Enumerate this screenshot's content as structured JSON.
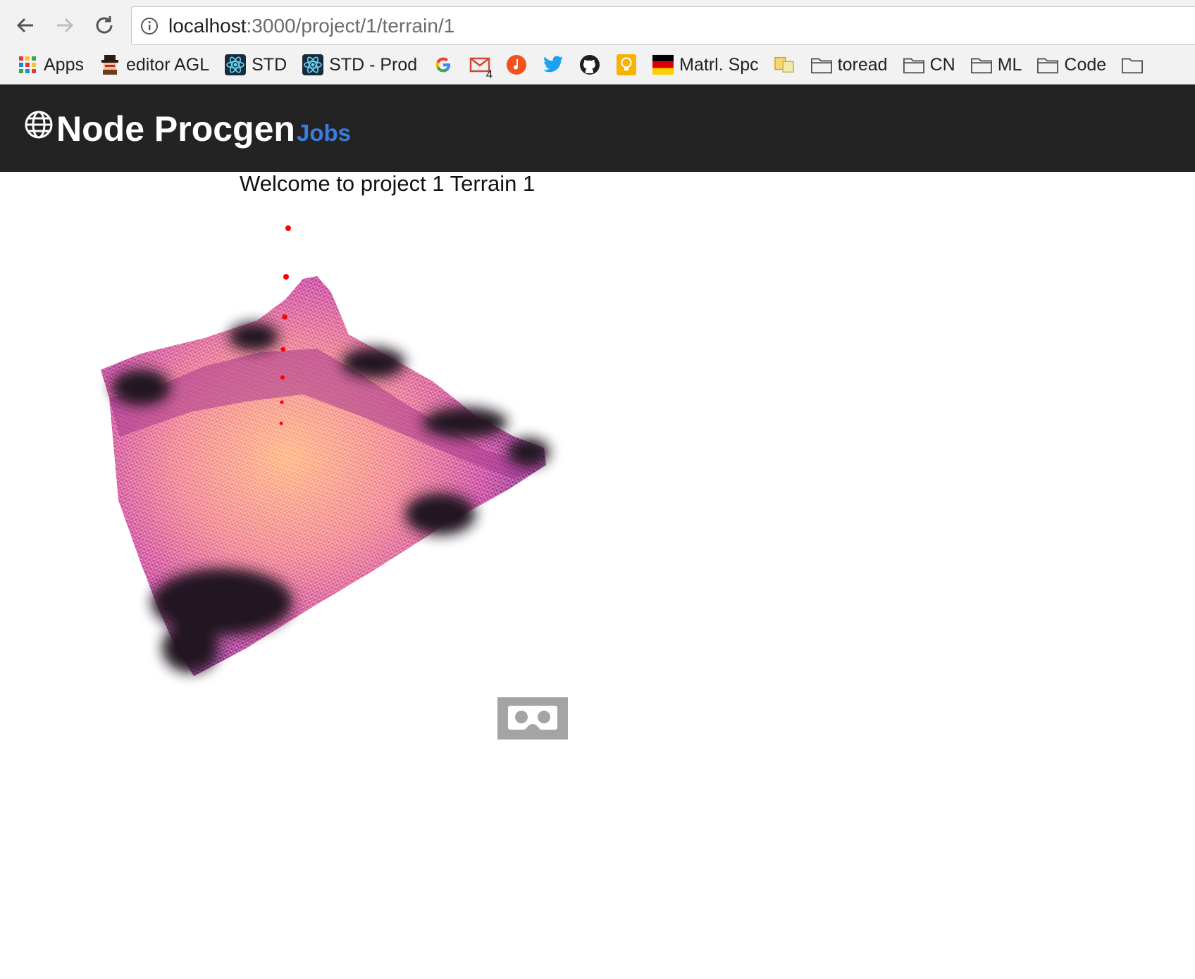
{
  "browser": {
    "url_host": "localhost",
    "url_path": ":3000/project/1/terrain/1",
    "bookmarks": [
      {
        "label": "Apps",
        "icon": "apps-grid-icon"
      },
      {
        "label": "editor AGL",
        "icon": "bot-icon"
      },
      {
        "label": "STD",
        "icon": "react-icon"
      },
      {
        "label": "STD - Prod",
        "icon": "react-icon"
      },
      {
        "label": "",
        "icon": "google-icon"
      },
      {
        "label": "",
        "icon": "gmail-icon",
        "badge": "4"
      },
      {
        "label": "",
        "icon": "music-icon"
      },
      {
        "label": "",
        "icon": "twitter-icon"
      },
      {
        "label": "",
        "icon": "github-icon"
      },
      {
        "label": "",
        "icon": "lightbulb-icon"
      },
      {
        "label": "Matrl. Spc",
        "icon": "flag-icon"
      },
      {
        "label": "",
        "icon": "gl-icon"
      },
      {
        "label": "toread",
        "icon": "folder-icon"
      },
      {
        "label": "CN",
        "icon": "folder-icon"
      },
      {
        "label": "ML",
        "icon": "folder-icon"
      },
      {
        "label": "Code",
        "icon": "folder-icon"
      }
    ]
  },
  "header": {
    "title": "Node Procgen",
    "nav_link": "Jobs"
  },
  "main": {
    "welcome": "Welcome to project 1 Terrain 1"
  },
  "colors": {
    "header_bg": "#232323",
    "link": "#3b7cdf",
    "terrain_peak": "#ff9a6e",
    "terrain_mid": "#c8409a",
    "terrain_low": "#2a1a2a",
    "marker": "#ff0000"
  }
}
